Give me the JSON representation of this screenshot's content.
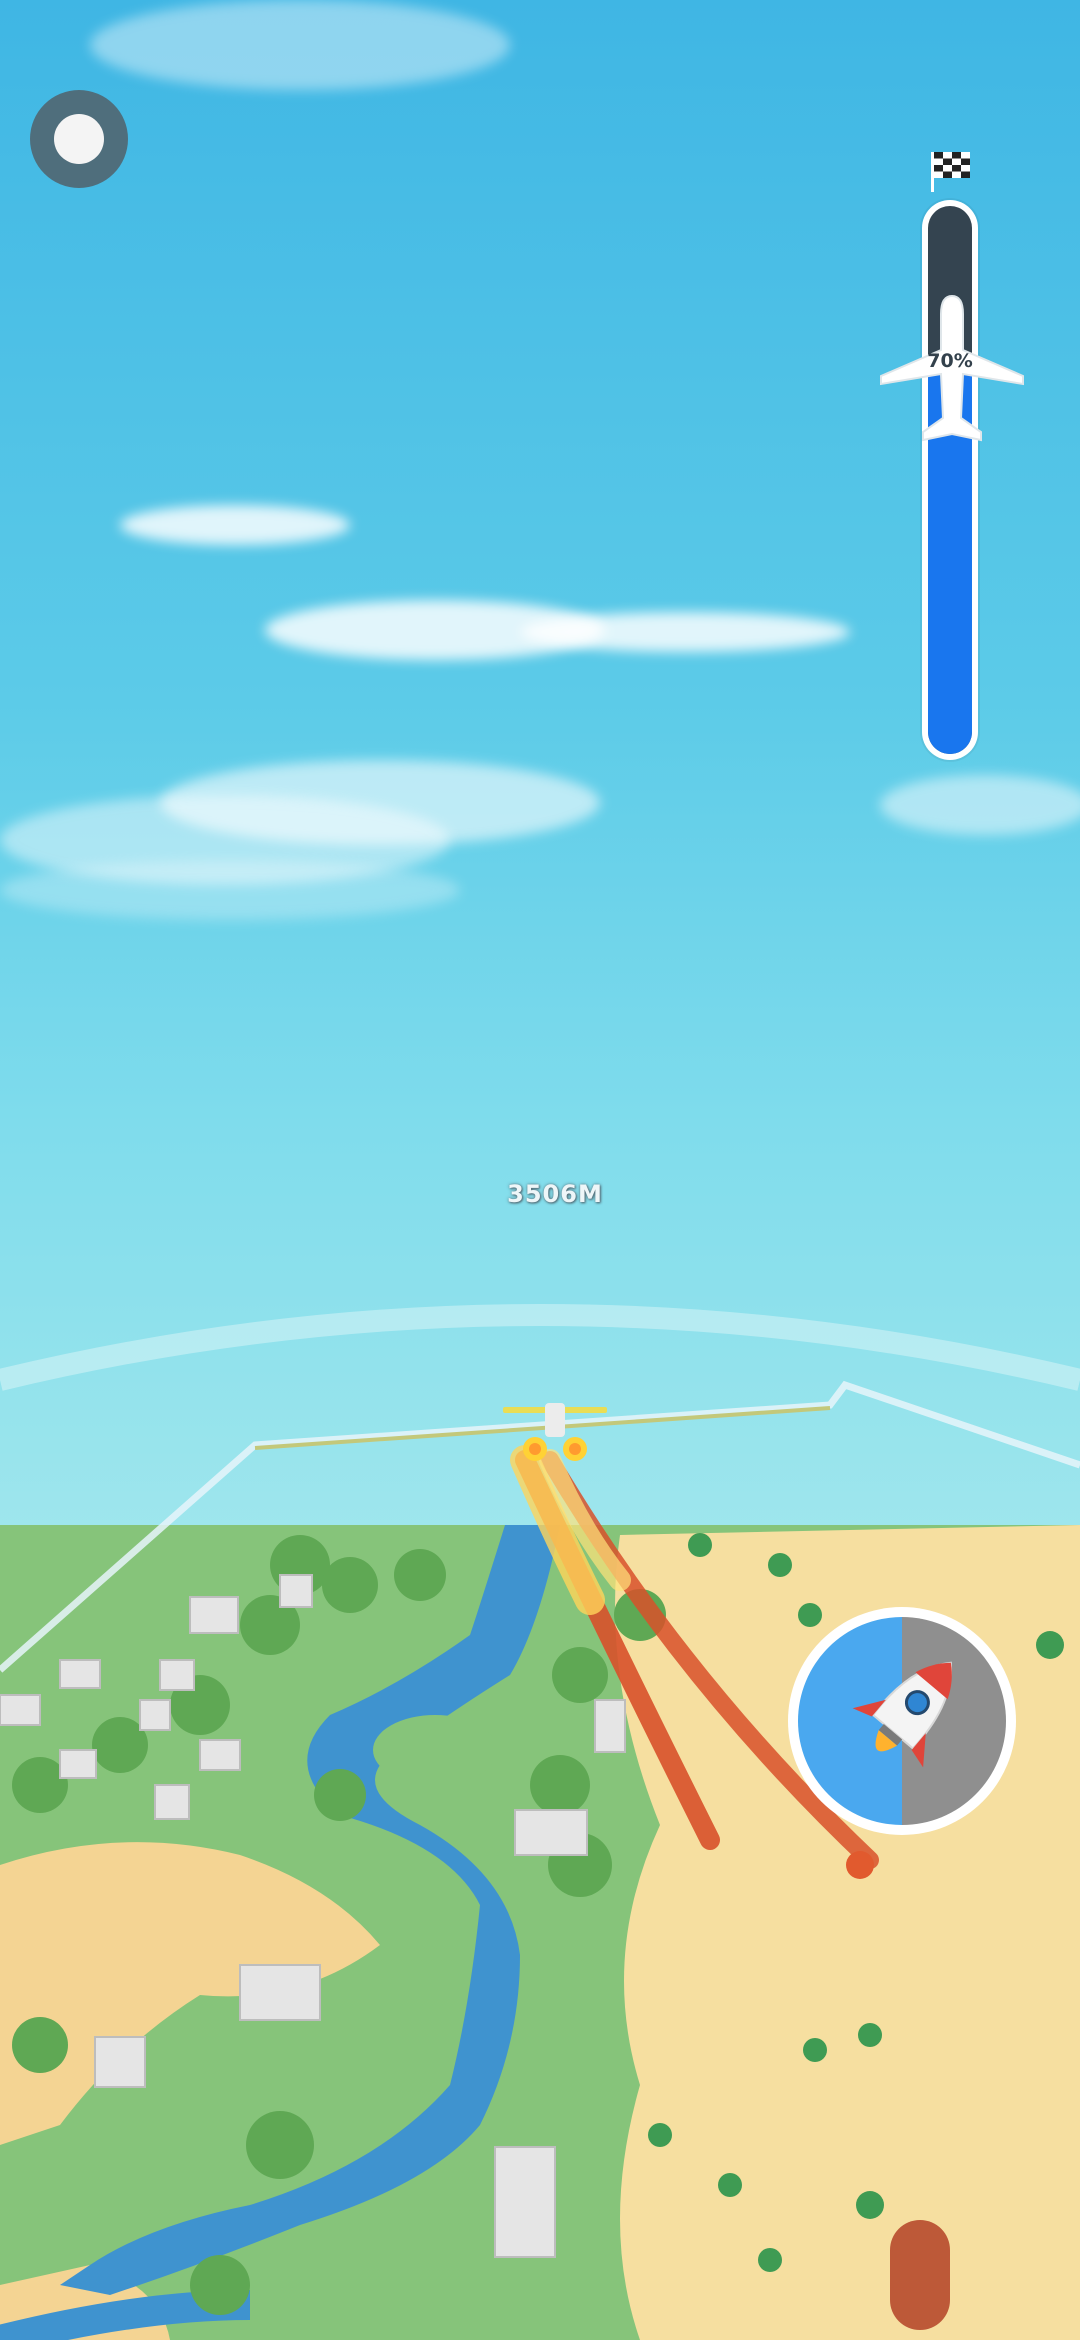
{
  "hud": {
    "altitude": "3506M",
    "progress_label": "70%",
    "progress_value": 0.7,
    "pause_icon": "pause-record-icon",
    "finish_icon": "checkered-flag-icon",
    "progress_marker_icon": "airplane-icon",
    "boost_icon": "rocket-icon"
  },
  "colors": {
    "progress_fill": "#1976ee",
    "progress_track": "#344450",
    "boost_left": "#4aa8ef",
    "boost_right": "#8f8f8f",
    "sky_top": "#3fb6e4",
    "sand": "#f6dfa0",
    "grass": "#86c47a",
    "river": "#3f93cf"
  }
}
